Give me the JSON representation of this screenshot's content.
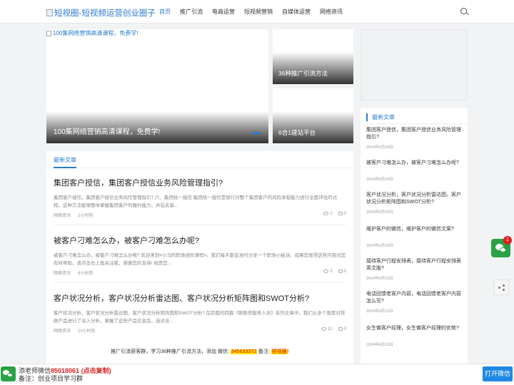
{
  "header": {
    "logo_alt": "短视圈-短视频运营创业圈子",
    "nav": [
      "首页",
      "推广引流",
      "电商运营",
      "短视频营销",
      "自媒体运营",
      "网络资讯"
    ],
    "active_nav": "首页",
    "search_icon": "search-icon"
  },
  "hero": {
    "image_alt": "100集网络营销高清课程，免费学!",
    "caption": "100集网络营销高清课程，免费学!"
  },
  "tiles": [
    {
      "caption": "36种推广引流方法"
    },
    {
      "caption": "6合1建站平台"
    }
  ],
  "main": {
    "tab": "最新文章",
    "articles": [
      {
        "title": "集团客户授信，集团客户授信业务风险管理指引?",
        "excerpt": "集团客户授信，集团客户授信业务风险管理指引? 六、集团统一授信 集团统一授信是银行对整个集团客户的风险承担能力进行全面评估的过程。这种方法能够整体掌握集团客户的履约能力，并在此基...",
        "category": "网络资讯",
        "time": "2小时前",
        "views": "2",
        "likes": "0"
      },
      {
        "title": "被客户刁难怎么办，被客户刁难怎么办呢?",
        "excerpt": "被客户刁难怎么办，被客户刁难怎么办呢? 欢迎来到#小马的职场进阶课程#。我们每天都会准时分享一个职场小秘诀。如果您觉得这些内容对您有所帮助，请点击右上角关注我，感谢您的支持! 视思您...",
        "category": "网络资讯",
        "time": "6小时前",
        "views": "3",
        "likes": "0"
      },
      {
        "title": "客户状况分析，客户状况分析雷达图、客户状况分析矩阵图和SWOT分析?",
        "excerpt": "客户状况分析，客户状况分析雷达图、客户状况分析矩阵图和SWOT分析? 在前面的四篇《致助贷服务人员》系列文章中，我们从多个角度对贷款产品进行了深入分析，掌握了这些产品信息后，选对合...",
        "category": "网络资讯",
        "time": "10小时前",
        "views": "10",
        "likes": "0"
      }
    ],
    "promo": {
      "before": "推广引流获客群，学习36种推广引流方法，添加 微信:",
      "wechat": "345633372",
      "middle": "备注:",
      "note": "短视圈",
      "end": "!"
    }
  },
  "sidebar": {
    "heading": "最新文章",
    "items": [
      {
        "title": "集团客户授信，集团客户授信业务风险管理指引?",
        "date": "2024年9月20日"
      },
      {
        "title": "被客户刁难怎么办，被客户刁难怎么办呢?",
        "date": "2024年9月20日"
      },
      {
        "title": "客户状况分析，客户状况分析雷达图、客户状况分析矩阵图和SWOT分析?",
        "date": "2024年9月19日"
      },
      {
        "title": "维护客户的微信，维护客户的微信文案?",
        "date": "2024年9月19日"
      },
      {
        "title": "接待客户行程安排表，接待客户行程安排表英文版?",
        "date": "2024年9月19日"
      },
      {
        "title": "电话回馈老客户内容，电话回馈老客户内容怎么写?",
        "date": "2024年9月19日"
      },
      {
        "title": "女生做客户经理，女生做客户经理的优势?",
        "date": "2024年9月19日"
      }
    ]
  },
  "floating": {
    "badge_count": "1",
    "wechat_icon": "wechat-icon",
    "share_icon": "share-icon"
  },
  "bottom_bar": {
    "contact_prefix": "添老师微信",
    "phone": "85018061",
    "copy_hint": "(点击复制)",
    "note": "备注：创业项目学习群",
    "open_button": "打开微信"
  },
  "colors": {
    "accent": "#2a7bd1",
    "wechat_green": "#2ba245",
    "badge_red": "#e02020",
    "highlight_yellow": "#ffe400"
  }
}
